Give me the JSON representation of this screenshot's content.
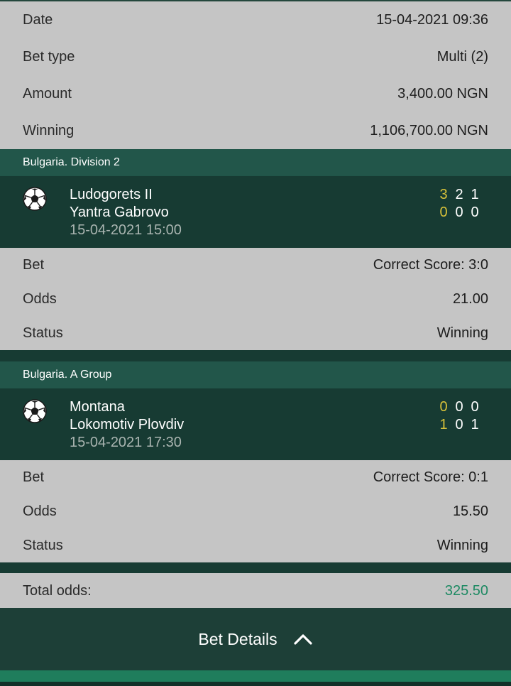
{
  "summary": {
    "date_label": "Date",
    "date_value": "15-04-2021 09:36",
    "bet_type_label": "Bet type",
    "bet_type_value": "Multi (2)",
    "amount_label": "Amount",
    "amount_value": "3,400.00 NGN",
    "winning_label": "Winning",
    "winning_value": "1,106,700.00 NGN"
  },
  "selections": [
    {
      "league": "Bulgaria. Division 2",
      "home_team": "Ludogorets II",
      "away_team": "Yantra Gabrovo",
      "match_time": "15-04-2021 15:00",
      "home_scores": [
        "3",
        "2",
        "1"
      ],
      "away_scores": [
        "0",
        "0",
        "0"
      ],
      "bet_label": "Bet",
      "bet_value": "Correct Score: 3:0",
      "odds_label": "Odds",
      "odds_value": "21.00",
      "status_label": "Status",
      "status_value": "Winning",
      "sport_icon": "soccer-ball-icon"
    },
    {
      "league": "Bulgaria. A Group",
      "home_team": "Montana",
      "away_team": "Lokomotiv Plovdiv",
      "match_time": "15-04-2021 17:30",
      "home_scores": [
        "0",
        "0",
        "0"
      ],
      "away_scores": [
        "1",
        "0",
        "1"
      ],
      "bet_label": "Bet",
      "bet_value": "Correct Score: 0:1",
      "odds_label": "Odds",
      "odds_value": "15.50",
      "status_label": "Status",
      "status_value": "Winning",
      "sport_icon": "soccer-ball-icon"
    }
  ],
  "total": {
    "label": "Total odds:",
    "value": "325.50"
  },
  "details_button": {
    "label": "Bet Details",
    "icon": "chevron-up-icon"
  },
  "colors": {
    "dark_green": "#173b33",
    "league_green": "#22564a",
    "accent_green": "#1e8a63",
    "score_yellow": "#d8c23a",
    "background": "#c5c5c5"
  }
}
